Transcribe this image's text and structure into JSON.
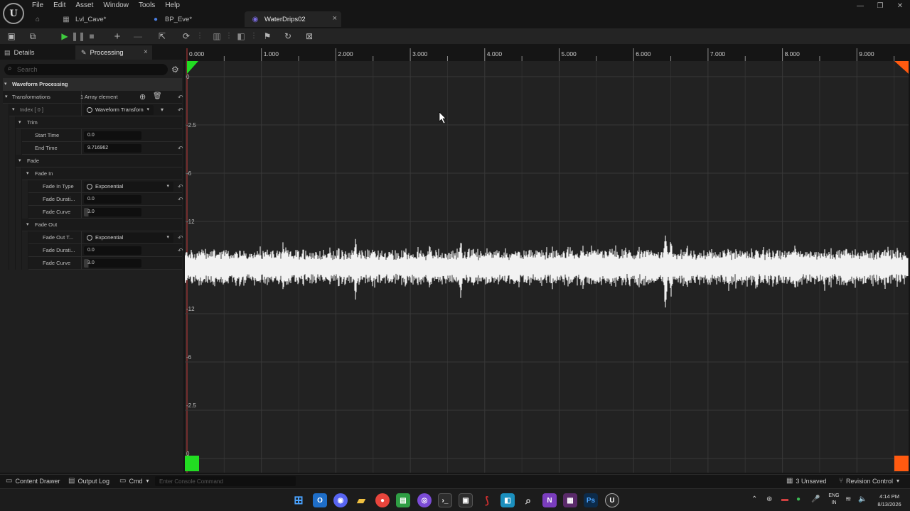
{
  "app": {
    "logo": "U",
    "menu": [
      "File",
      "Edit",
      "Asset",
      "Window",
      "Tools",
      "Help"
    ],
    "tabs": [
      {
        "label": "Lvl_Cave*",
        "icon": "level-icon"
      },
      {
        "label": "BP_Eve*",
        "icon": "blueprint-icon"
      },
      {
        "label": "WaterDrips02",
        "icon": "sound-wave-icon",
        "active": true
      }
    ]
  },
  "panel": {
    "tabs": [
      "Details",
      "Processing"
    ],
    "search_placeholder": "Search",
    "category": "Waveform Processing",
    "transformations": {
      "label": "Transformations",
      "count": "1 Array element"
    },
    "index": {
      "label": "Index [ 0 ]",
      "value": "Waveform Transforn"
    },
    "trim": {
      "label": "Trim",
      "start_time_label": "Start Time",
      "start_time": "0.0",
      "end_time_label": "End Time",
      "end_time": "9.716962"
    },
    "fade": {
      "label": "Fade",
      "fade_in": {
        "label": "Fade In",
        "type_label": "Fade In Type",
        "type": "Exponential",
        "duration_label": "Fade Durati...",
        "duration": "0.0",
        "curve_label": "Fade Curve",
        "curve": "3.0"
      },
      "fade_out": {
        "label": "Fade Out",
        "type_label": "Fade Out T...",
        "type": "Exponential",
        "duration_label": "Fade Durati...",
        "duration": "0.0",
        "curve_label": "Fade Curve",
        "curve": "3.0"
      }
    }
  },
  "waveform": {
    "time_ticks": [
      "0.000",
      "1.000",
      "2.000",
      "3.000",
      "4.000",
      "5.000",
      "6.000",
      "7.000",
      "8.000",
      "9.000"
    ],
    "db_labels_top": [
      "0",
      "-2.5",
      "-6",
      "-12"
    ],
    "db_labels_bottom": [
      "-12",
      "-6",
      "-2.5",
      "0"
    ],
    "colors": {
      "start_marker": "#22dd22",
      "end_marker": "#ff5a10",
      "background": "#222222",
      "grid": "#3a3a3a",
      "wave": "#f2f2f2"
    }
  },
  "status": {
    "content_drawer": "Content Drawer",
    "output_log": "Output Log",
    "cmd": "Cmd",
    "console_placeholder": "Enter Console Command",
    "unsaved": "3 Unsaved",
    "revision_control": "Revision Control"
  },
  "taskbar": {
    "lang_line1": "ENG",
    "lang_line2": "IN",
    "time": "4:14 PM",
    "date": "8/13/2026"
  }
}
